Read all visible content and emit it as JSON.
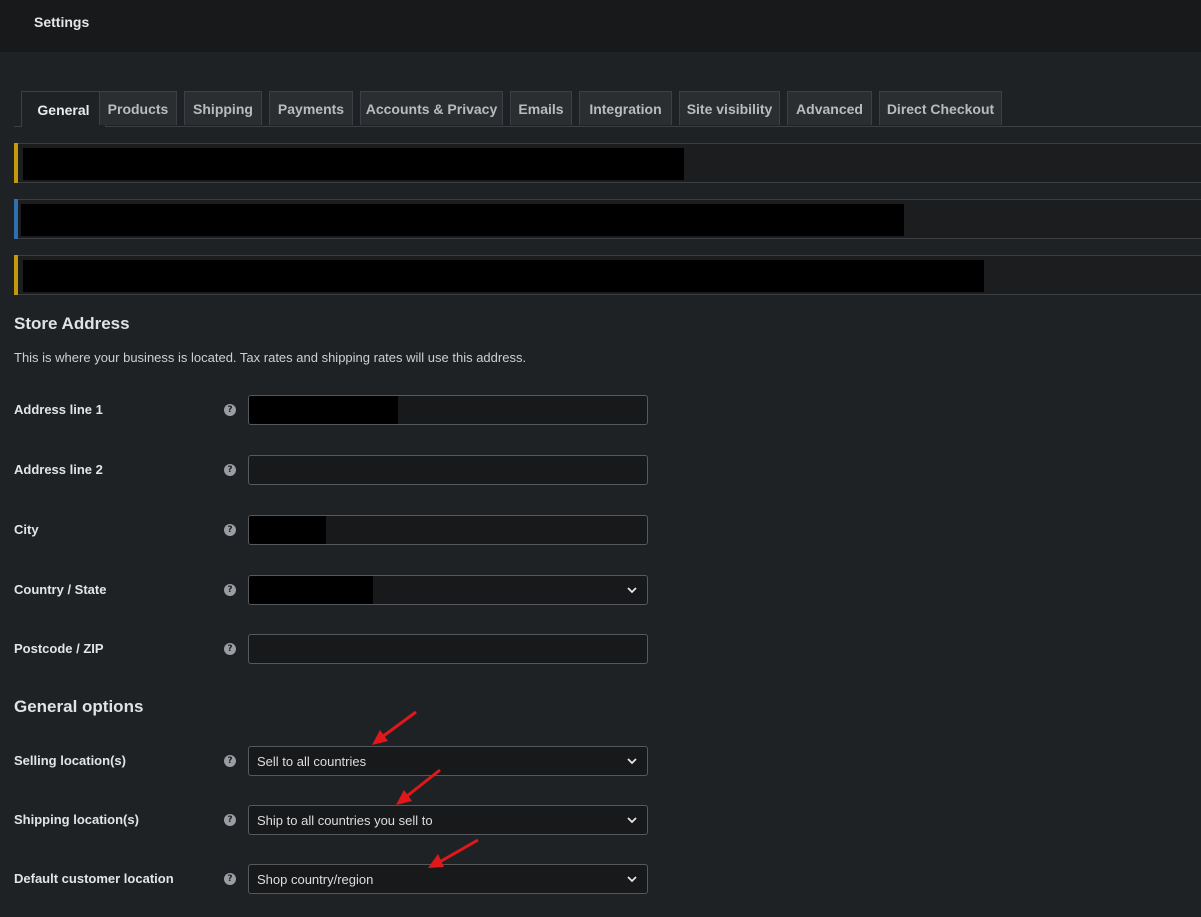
{
  "header": {
    "title": "Settings"
  },
  "tabs": [
    {
      "label": "General",
      "active": true
    },
    {
      "label": "Products"
    },
    {
      "label": "Shipping"
    },
    {
      "label": "Payments"
    },
    {
      "label": "Accounts & Privacy"
    },
    {
      "label": "Emails"
    },
    {
      "label": "Integration"
    },
    {
      "label": "Site visibility"
    },
    {
      "label": "Advanced"
    },
    {
      "label": "Direct Checkout"
    }
  ],
  "notices": [
    {
      "accent": "#c49a0c"
    },
    {
      "accent": "#2d6fb0"
    },
    {
      "accent": "#c49a0c"
    }
  ],
  "store_address": {
    "title": "Store Address",
    "description": "This is where your business is located. Tax rates and shipping rates will use this address.",
    "fields": [
      {
        "label": "Address line 1",
        "help_icon": "?"
      },
      {
        "label": "Address line 2",
        "help_icon": "?"
      },
      {
        "label": "City",
        "help_icon": "?"
      },
      {
        "label": "Country / State",
        "help_icon": "?"
      },
      {
        "label": "Postcode / ZIP",
        "help_icon": "?"
      }
    ]
  },
  "general_options": {
    "title": "General options",
    "fields": [
      {
        "label": "Selling location(s)",
        "value": "Sell to all countries",
        "help_icon": "?"
      },
      {
        "label": "Shipping location(s)",
        "value": "Ship to all countries you sell to",
        "help_icon": "?"
      },
      {
        "label": "Default customer location",
        "value": "Shop country/region",
        "help_icon": "?"
      }
    ]
  },
  "colors": {
    "annotation_arrow": "#e0181b",
    "background": "#1f2224"
  }
}
